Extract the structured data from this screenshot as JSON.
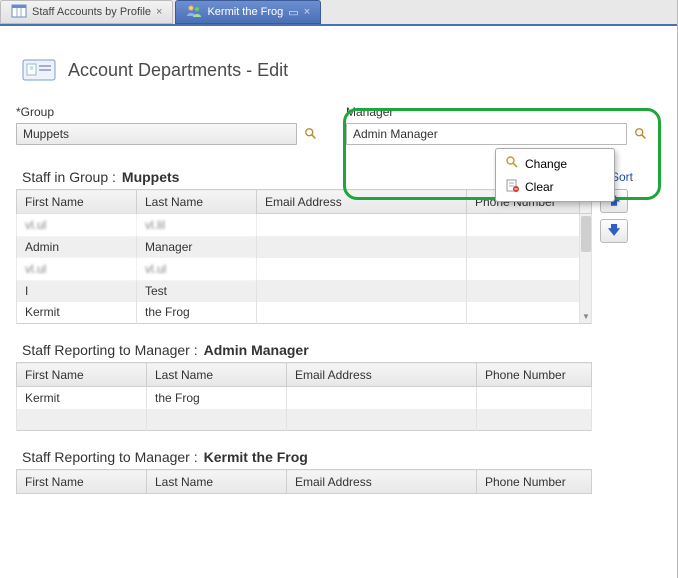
{
  "tabs": {
    "inactive": {
      "label": "Staff Accounts by Profile"
    },
    "active": {
      "label": "Kermit the Frog"
    }
  },
  "page": {
    "title": "Account Departments - Edit"
  },
  "fields": {
    "group": {
      "label": "Group",
      "value": "Muppets"
    },
    "manager": {
      "label": "Manager",
      "value": "Admin Manager"
    }
  },
  "contextMenu": {
    "change": "Change",
    "clear": "Clear"
  },
  "sort_label": "Sort",
  "columns": {
    "first": "First Name",
    "last": "Last Name",
    "email": "Email Address",
    "phone": "Phone Number"
  },
  "sections": {
    "staffInGroup": {
      "label": "Staff in Group :",
      "value": "Muppets",
      "rows": [
        {
          "first": "vl.ul",
          "last": "vl.lil",
          "email": "",
          "phone": "",
          "blurred": true
        },
        {
          "first": "Admin",
          "last": "Manager",
          "email": "",
          "phone": ""
        },
        {
          "first": "vl.ul",
          "last": "vl.ul",
          "email": "",
          "phone": "",
          "blurred": true
        },
        {
          "first": "I",
          "last": "Test",
          "email": "",
          "phone": ""
        },
        {
          "first": "Kermit",
          "last": "the Frog",
          "email": "",
          "phone": ""
        }
      ]
    },
    "reporting1": {
      "label": "Staff Reporting to Manager :",
      "value": "Admin Manager",
      "rows": [
        {
          "first": "Kermit",
          "last": "the Frog",
          "email": "",
          "phone": ""
        },
        {
          "first": "",
          "last": "",
          "email": "",
          "phone": ""
        }
      ]
    },
    "reporting2": {
      "label": "Staff Reporting to Manager :",
      "value": "Kermit the Frog",
      "rows": []
    }
  }
}
